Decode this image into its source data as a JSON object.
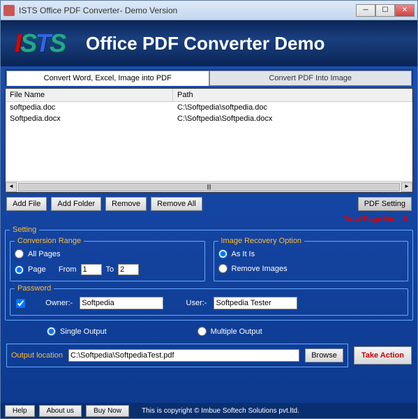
{
  "titlebar": {
    "title": "ISTS Office PDF Converter- Demo Version"
  },
  "header": {
    "logo_chars": [
      "I",
      "S",
      "T",
      "S"
    ],
    "title": "Office PDF Converter Demo"
  },
  "tabs": {
    "tab1": "Convert Word, Excel, Image into PDF",
    "tab2": "Convert PDF Into Image"
  },
  "file_table": {
    "col_name": "File Name",
    "col_path": "Path",
    "rows": [
      {
        "name": "softpedia.doc",
        "path": "C:\\Softpedia\\softpedia.doc"
      },
      {
        "name": "Softpedia.docx",
        "path": "C:\\Softpedia\\Softpedia.docx"
      }
    ]
  },
  "buttons": {
    "add_file": "Add File",
    "add_folder": "Add Folder",
    "remove": "Remove",
    "remove_all": "Remove All",
    "pdf_setting": "PDF Setting"
  },
  "total": {
    "label": "Total Page No:-",
    "value": "0"
  },
  "setting": {
    "legend": "Setting",
    "conversion": {
      "legend": "Conversion Range",
      "all_pages": "All Pages",
      "page": "Page",
      "from": "From",
      "to": "To",
      "from_val": "1",
      "to_val": "2"
    },
    "recovery": {
      "legend": "Image Recovery Option",
      "as_is": "As It Is",
      "remove": "Remove Images"
    },
    "password": {
      "legend": "Password",
      "owner_label": "Owner:-",
      "owner_val": "Softpedia",
      "user_label": "User:-",
      "user_val": "Softpedia Tester"
    }
  },
  "output_mode": {
    "single": "Single Output",
    "multiple": "Multiple Output"
  },
  "output": {
    "label": "Output location",
    "value": "C:\\Softpedia\\SoftpediaTest.pdf",
    "browse": "Browse",
    "action": "Take Action"
  },
  "footer": {
    "help": "Help",
    "about": "About us",
    "buy": "Buy Now",
    "copyright": "This is copyright © Imbue Softech Solutions pvt.ltd."
  }
}
